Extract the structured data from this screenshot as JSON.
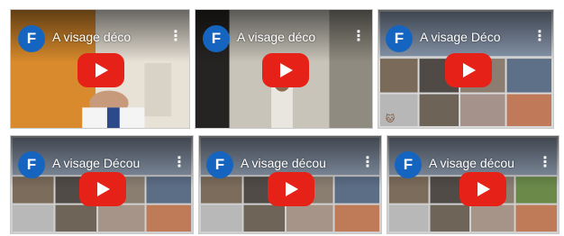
{
  "videos": [
    {
      "channel_initial": "F",
      "title": "A visage déco"
    },
    {
      "channel_initial": "F",
      "title": "A visage déco"
    },
    {
      "channel_initial": "F",
      "title": "A visage Déco"
    },
    {
      "channel_initial": "F",
      "title": "A visage Décou"
    },
    {
      "channel_initial": "F",
      "title": "A visage décou"
    },
    {
      "channel_initial": "F",
      "title": "A visage décou"
    }
  ],
  "icons": {
    "more": "more-vert-icon",
    "play": "play-button-icon"
  },
  "colors": {
    "avatar": "#1565c0",
    "play": "#e62117"
  }
}
